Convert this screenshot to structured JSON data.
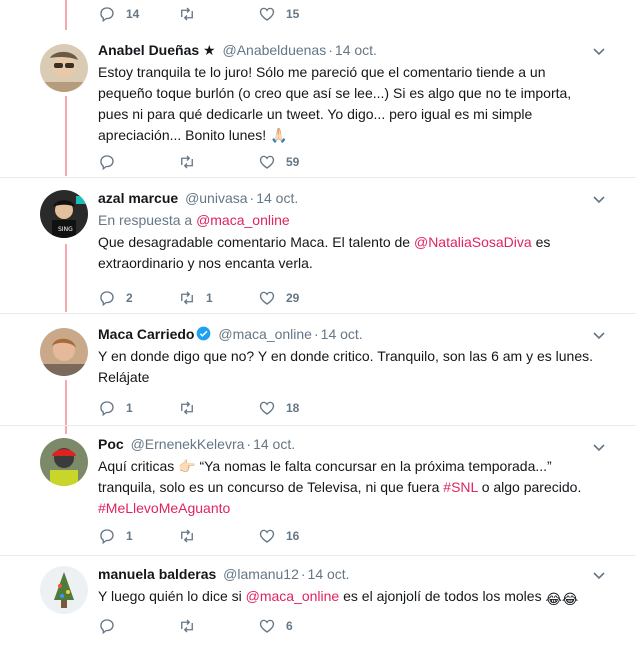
{
  "top_actions": {
    "replies": "14",
    "retweets": "",
    "likes": "15"
  },
  "tweets": [
    {
      "name": "Anabel Dueñas",
      "badge": "★",
      "handle": "@Anabelduenas",
      "dot": "·",
      "time": "14 oct.",
      "text": "Estoy tranquila te lo juro! Sólo me pareció que el comentario tiende a un pequeño toque burlón (o creo que así se lee...) Si es algo que no te importa, pues ni para qué dedicarle un tweet. Yo digo...  pero igual es mi simple apreciación... Bonito lunes! 🙏🏻",
      "replies": "",
      "retweets": "",
      "likes": "59"
    },
    {
      "name": "azal marcue",
      "handle": "@univasa",
      "dot": "·",
      "time": "14 oct.",
      "reply_prefix": "En respuesta a",
      "reply_mention": "@maca_online",
      "text_1": "Que desagradable comentario Maca. El talento de",
      "text_mention": "@NataliaSosaDiva",
      "text_2": "es extraordinario y nos encanta verla.",
      "replies": "2",
      "retweets": "1",
      "likes": "29"
    },
    {
      "name": "Maca Carriedo",
      "handle": "@maca_online",
      "dot": "·",
      "time": "14 oct.",
      "text": "Y en donde digo que no? Y en donde critico. Tranquilo, son las 6 am y es lunes. Relájate",
      "replies": "1",
      "retweets": "",
      "likes": "18"
    },
    {
      "name": "Poc",
      "handle": "@ErnenekKelevra",
      "dot": "·",
      "time": "14 oct.",
      "text_1": "Aquí criticas 👉🏻 “Ya nomas le falta concursar en la próxima temporada...” tranquila, solo es un concurso de Televisa, ni que fuera",
      "text_hashtag": "#SNL",
      "text_2": "o algo parecido.",
      "text_hashtag_2": "#MeLlevoMeAguanto",
      "replies": "1",
      "retweets": "",
      "likes": "16"
    },
    {
      "name": "manuela balderas",
      "handle": "@lamanu12",
      "dot": "·",
      "time": "14 oct.",
      "text_1": "Y luego quién lo dice si",
      "text_mention": "@maca_online",
      "text_2": "es el ajonjolí de todos los moles",
      "text_emoji": "😂😂",
      "replies": "",
      "retweets": "",
      "likes": "6"
    }
  ],
  "colors": {
    "accent": "#e0245e",
    "thread_line": "#f6a8ad",
    "verified": "#1da1f2",
    "muted": "#657786"
  }
}
